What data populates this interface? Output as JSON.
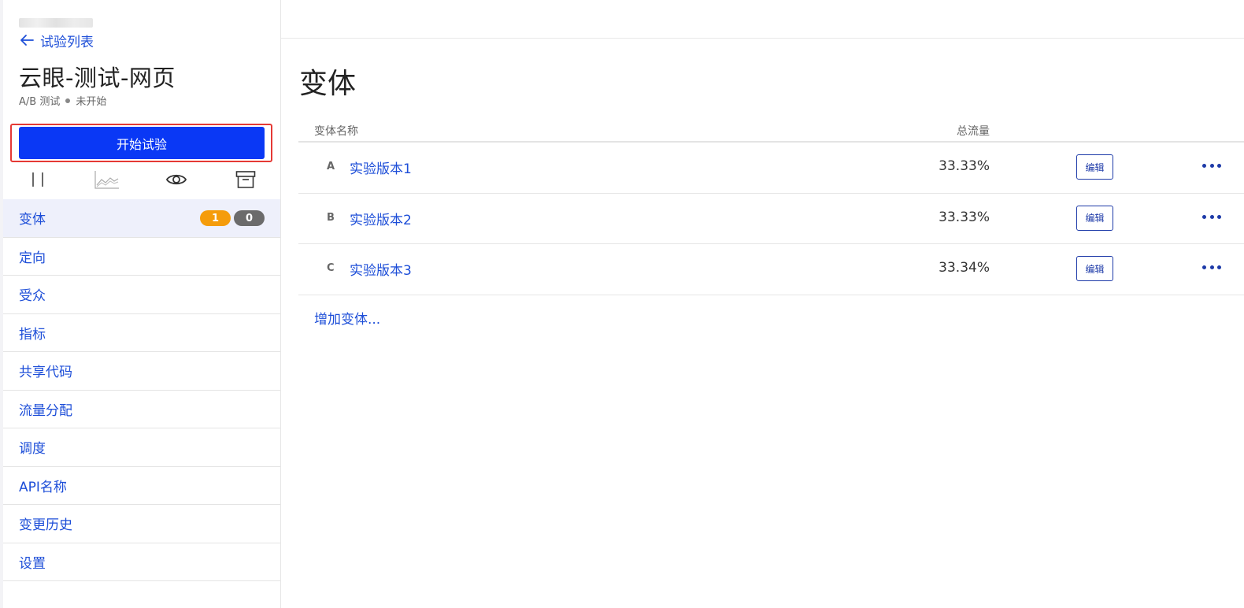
{
  "sidebar": {
    "back_label": "试验列表",
    "title": "云眼-测试-网页",
    "meta_type": "A/B 测试",
    "meta_status": "未开始",
    "start_button": "开始试验",
    "icons": [
      "pause-icon",
      "chart-icon",
      "eye-icon",
      "archive-icon"
    ],
    "items": [
      {
        "label": "变体",
        "active": true
      },
      {
        "label": "定向"
      },
      {
        "label": "受众"
      },
      {
        "label": "指标"
      },
      {
        "label": "共享代码"
      },
      {
        "label": "流量分配"
      },
      {
        "label": "调度"
      },
      {
        "label": "API名称"
      },
      {
        "label": "变更历史"
      },
      {
        "label": "设置"
      }
    ],
    "badges": {
      "orange": "1",
      "gray": "0"
    }
  },
  "main": {
    "title": "变体",
    "table": {
      "headers": {
        "name": "变体名称",
        "traffic": "总流量"
      },
      "rows": [
        {
          "letter": "A",
          "name": "实验版本1",
          "traffic": "33.33%",
          "action": "编辑"
        },
        {
          "letter": "B",
          "name": "实验版本2",
          "traffic": "33.33%",
          "action": "编辑"
        },
        {
          "letter": "C",
          "name": "实验版本3",
          "traffic": "33.34%",
          "action": "编辑"
        }
      ]
    },
    "add_label": "增加变体..."
  },
  "colors": {
    "accent": "#1d4ed8",
    "primary_button": "#0a38f5",
    "highlight_border": "#e53935",
    "badge_orange": "#f59c0b",
    "badge_gray": "#6b6b6b"
  }
}
